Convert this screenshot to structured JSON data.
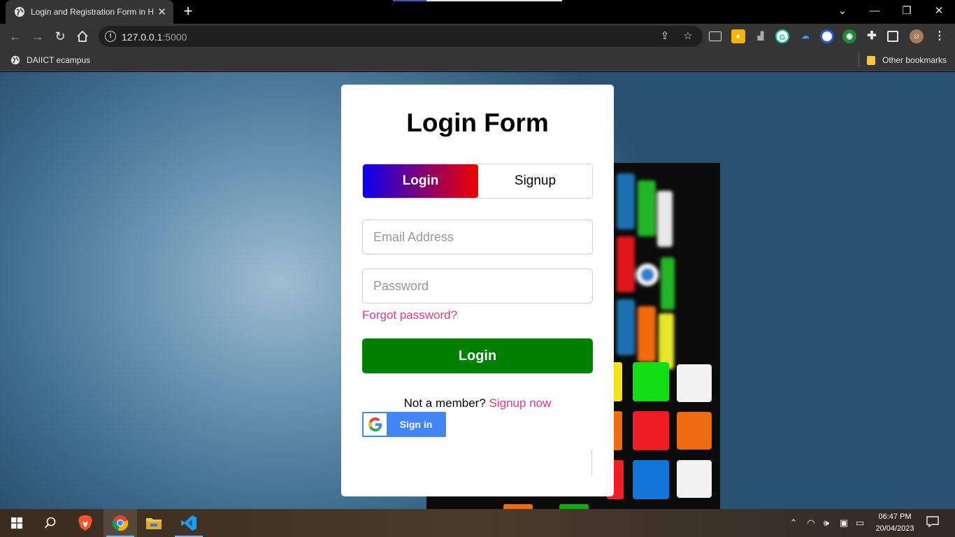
{
  "browser": {
    "tab_title": "Login and Registration Form in H",
    "new_tab_symbol": "+",
    "url_host": "127.0.0.1",
    "url_port": ":5000",
    "bookmarks": [
      {
        "label": "DAIICT ecampus",
        "icon": "globe-icon"
      }
    ],
    "other_bookmarks": "Other bookmarks"
  },
  "form": {
    "title": "Login Form",
    "tabs": {
      "login": "Login",
      "signup": "Signup"
    },
    "active_tab": "login",
    "email_placeholder": "Email Address",
    "password_placeholder": "Password",
    "forgot": "Forgot password?",
    "submit": "Login",
    "not_member": "Not a member?",
    "signup_now": "Signup now",
    "google_signin": "Sign in"
  },
  "taskbar": {
    "time": "06:47 PM",
    "date": "20/04/2023",
    "apps": [
      "windows-start",
      "search",
      "brave",
      "chrome",
      "file-explorer",
      "vscode"
    ],
    "active_app": "chrome"
  },
  "colors": {
    "gradient_start": "#0a00f0",
    "gradient_end": "#f00000",
    "login_button": "#008000",
    "link_pink": "#e4398c",
    "google_blue": "#4285f4"
  }
}
